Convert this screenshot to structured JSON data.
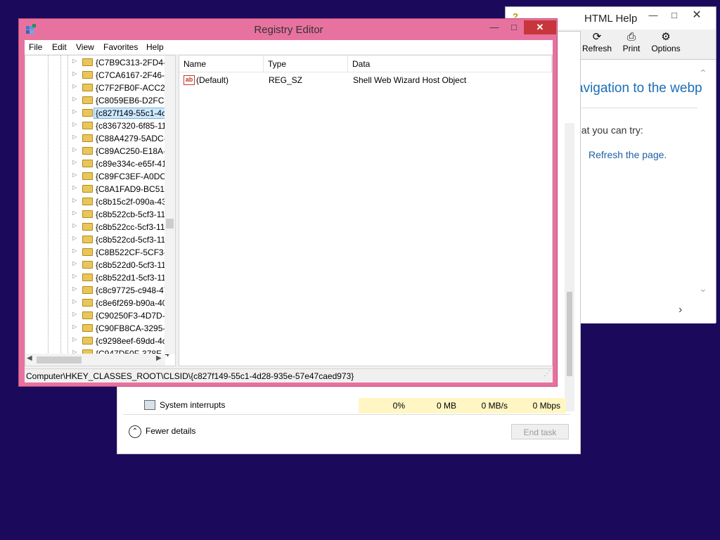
{
  "html_help": {
    "title": "HTML Help",
    "toolbar": [
      "Refresh",
      "Print",
      "Options"
    ],
    "heading": "avigation to the webp",
    "try_text": "hat you can try:",
    "link": "Refresh the page."
  },
  "task_manager": {
    "process_name": "System interrupts",
    "cpu": "0%",
    "memory": "0 MB",
    "disk": "0 MB/s",
    "network": "0 Mbps",
    "fewer_details": "Fewer details",
    "end_task": "End task"
  },
  "registry": {
    "title": "Registry Editor",
    "menu": [
      "File",
      "Edit",
      "View",
      "Favorites",
      "Help"
    ],
    "tree_items": [
      "{C7B9C313-2FD4-4",
      "{C7CA6167-2F46-4",
      "{C7F2FB0F-ACC2-",
      "{C8059EB6-D2FC-4",
      "{c827f149-55c1-4c",
      "{c8367320-6f85-11",
      "{C88A4279-5ADC-",
      "{C89AC250-E18A-4",
      "{c89e334c-e65f-41",
      "{C89FC3EF-A0DC-",
      "{C8A1FAD9-BC51-",
      "{c8b15c2f-090a-43",
      "{c8b522cb-5cf3-11",
      "{c8b522cc-5cf3-11",
      "{c8b522cd-5cf3-11",
      "{C8B522CF-5CF3-1",
      "{c8b522d0-5cf3-11",
      "{c8b522d1-5cf3-11",
      "{c8c97725-c948-47",
      "{c8e6f269-b90a-40",
      "{C90250F3-4D7D-4",
      "{C90FB8CA-3295-4",
      "{c9298eef-69dd-4c",
      "{C947D50F-378E-4"
    ],
    "selected_index": 4,
    "columns": [
      "Name",
      "Type",
      "Data"
    ],
    "values": [
      {
        "name": "(Default)",
        "type": "REG_SZ",
        "data": "Shell Web Wizard Host Object"
      }
    ],
    "status_path": "Computer\\HKEY_CLASSES_ROOT\\CLSID\\{c827f149-55c1-4d28-935e-57e47caed973}"
  }
}
